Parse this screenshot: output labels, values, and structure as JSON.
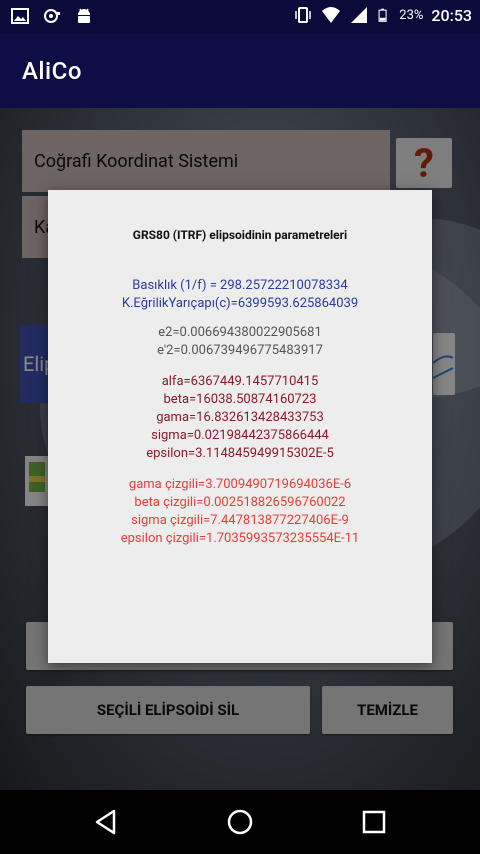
{
  "status_bar": {
    "battery_percent": "23%",
    "time": "20:53"
  },
  "app": {
    "title": "AliCo"
  },
  "form": {
    "coordinate_system": "Coğrafi Koordinat Sistemi",
    "second_field_partial": "Ka",
    "help_button": "?",
    "ellipsoid_button_partial": "Elip"
  },
  "buttons": {
    "delete_selected": "SEÇİLİ ELİPSOİDİ SİL",
    "clear": "TEMİZLE"
  },
  "dialog": {
    "title": "GRS80 (ITRF)  elipsoidinin parametreleri",
    "flattening": "Basıklık (1/f) = 298.25722210078334",
    "radius": "K.EğrilikYarıçapı(c)=6399593.625864039",
    "e2": "e2=0.006694380022905681",
    "e2_prime": "e'2=0.006739496775483917",
    "alfa": "alfa=6367449.1457710415",
    "beta": "beta=16038.50874160723",
    "gama": "gama=16.832613428433753",
    "sigma": "sigma=0.02198442375866444",
    "epsilon": "epsilon=3.114845949915302E-5",
    "gama_cizgili": "gama çizgili=3.7009490719694036E-6",
    "beta_cizgili": "beta çizgili=0.0025188265967600​22",
    "sigma_cizgili": "sigma çizgili=7.447813877227406E-9",
    "epsilon_cizgili": "epsilon çizgili=1.7035993573235554E-11"
  },
  "colors": {
    "app_bar": "#0e0e47",
    "status_bar": "#0b0b3b",
    "accent_blue": "#3f51b5",
    "help_red": "#b03010"
  }
}
